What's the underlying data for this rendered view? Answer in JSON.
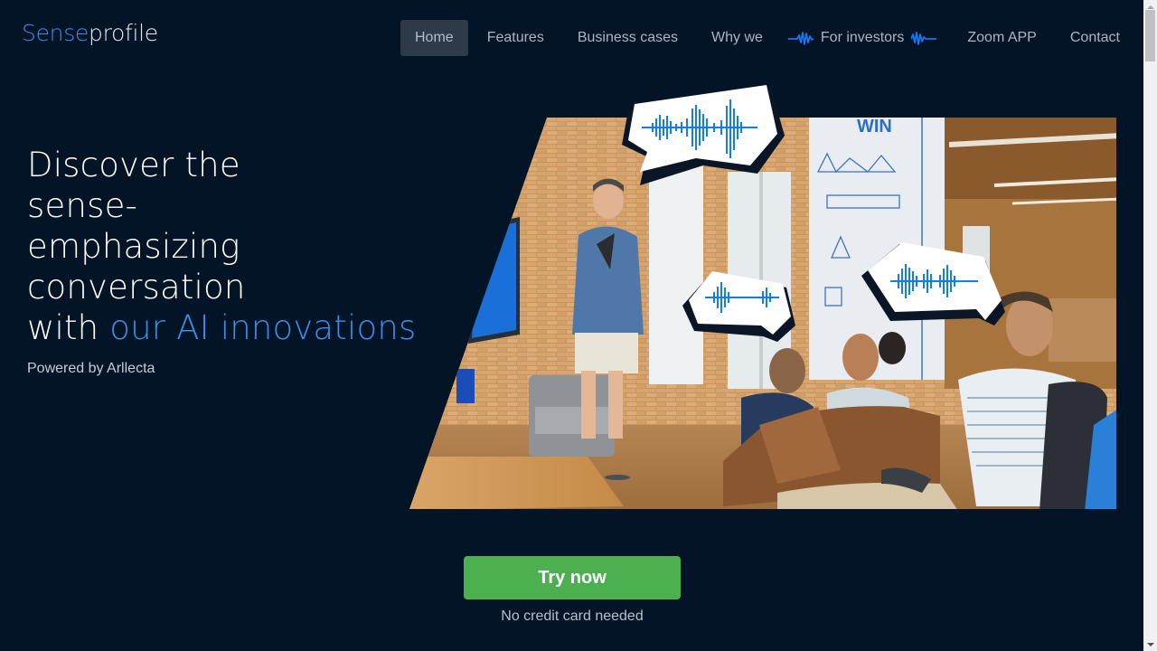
{
  "brand": {
    "part1": "Sense",
    "part2": "profile"
  },
  "nav": {
    "items": [
      {
        "label": "Home",
        "active": true
      },
      {
        "label": "Features"
      },
      {
        "label": "Business cases"
      },
      {
        "label": "Why we"
      },
      {
        "label": "For investors",
        "icons": [
          "waveform-icon",
          "waveform-icon"
        ]
      },
      {
        "label": "Zoom APP"
      },
      {
        "label": "Contact"
      }
    ]
  },
  "hero": {
    "title_lines": [
      "Discover the",
      "sense-",
      "emphasizing",
      "conversation"
    ],
    "title_last_prefix": "with ",
    "title_accent": "our AI innovations",
    "subtitle": "Powered by Arllecta",
    "image": {
      "description": "Presenter speaking to seated audience in a brick-walled office, with three speech bubbles containing blue voice waveforms",
      "icons": [
        "speech-bubble-waveform-icon",
        "speech-bubble-waveform-icon",
        "speech-bubble-waveform-icon"
      ]
    }
  },
  "cta": {
    "button_label": "Try now",
    "note": "No credit card needed"
  },
  "colors": {
    "background": "#031426",
    "accent_blue": "#3b90e6",
    "waveform_blue": "#0f7bff",
    "cta_green": "#4caf50",
    "nav_active_bg": "#2c3a4a"
  }
}
